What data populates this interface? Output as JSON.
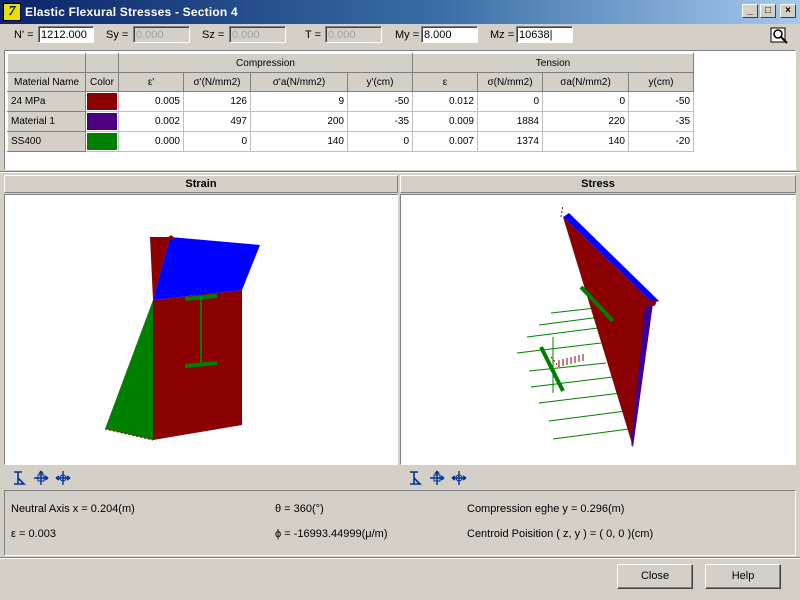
{
  "window": {
    "title": "Elastic Flexural Stresses - Section 4",
    "app_icon_glyph": "7",
    "buttons": {
      "minimize": "_",
      "maximize": "□",
      "close": "×"
    }
  },
  "forces": [
    {
      "label": "N' =",
      "value": "1212.000",
      "disabled": false
    },
    {
      "label": "Sy =",
      "value": "0.000",
      "disabled": true
    },
    {
      "label": "Sz =",
      "value": "0.000",
      "disabled": true
    },
    {
      "label": "T =",
      "value": "0.000",
      "disabled": true
    },
    {
      "label": "My =",
      "value": "8.000",
      "disabled": false
    },
    {
      "label": "Mz =",
      "value": "10638|",
      "disabled": false
    }
  ],
  "table": {
    "group_compression": "Compression",
    "group_tension": "Tension",
    "headers": [
      "Material Name",
      "Color",
      "ε'",
      "σ'(N/mm2)",
      "σ'a(N/mm2)",
      "y'(cm)",
      "ε",
      "σ(N/mm2)",
      "σa(N/mm2)",
      "y(cm)"
    ],
    "rows": [
      {
        "name": "24 MPa",
        "color": "#8b0000",
        "values": [
          "0.005",
          "126",
          "9",
          "-50",
          "0.012",
          "0",
          "0",
          "-50"
        ]
      },
      {
        "name": "Material 1",
        "color": "#4b0082",
        "values": [
          "0.002",
          "497",
          "200",
          "-35",
          "0.009",
          "1884",
          "220",
          "-35"
        ]
      },
      {
        "name": "SS400",
        "color": "#008000",
        "values": [
          "0.000",
          "0",
          "140",
          "0",
          "0.007",
          "1374",
          "140",
          "-20"
        ]
      }
    ]
  },
  "panels": {
    "strain_title": "Strain",
    "stress_title": "Stress"
  },
  "info": {
    "neutral_axis": "Neutral Axis x = 0.204(m)",
    "epsilon": "ε = 0.003",
    "theta": "θ = 360(°)",
    "phi": "ϕ = -16993.44999(μ/m)",
    "compression_edge": "Compression eghe y = 0.296(m)",
    "centroid": "Centroid Poisition ( z, y ) = ( 0, 0 )(cm)"
  },
  "buttons": {
    "close": "Close",
    "help": "Help"
  },
  "colors": {
    "concrete": "#8b0000",
    "plane": "#0000ff",
    "steel": "#008000"
  },
  "icons": [
    "app-icon",
    "magnifier-icon",
    "section-tool-icon",
    "rotate-tool-icon",
    "pan-tool-icon"
  ]
}
